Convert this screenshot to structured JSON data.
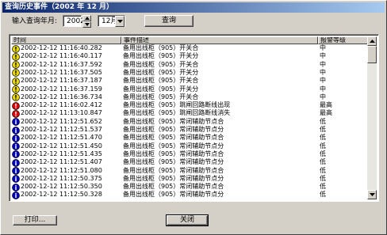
{
  "window": {
    "title": "查询历史事件（2002 年 12 月）"
  },
  "query": {
    "label": "输入查询年月:",
    "year": "2002",
    "month": "12月",
    "button": "查询"
  },
  "table": {
    "columns": [
      "时间",
      "事件描述",
      "报警等级"
    ],
    "rows": [
      {
        "icon": "warning-icon",
        "time": "2002-12-12   11:16:40.282",
        "desc": "备用出线柜（905）开关合",
        "level": "中"
      },
      {
        "icon": "warning-icon",
        "time": "2002-12-12   11:16:40.117",
        "desc": "备用出线柜（905）开关分",
        "level": "中"
      },
      {
        "icon": "warning-icon",
        "time": "2002-12-12   11:16:37.592",
        "desc": "备用出线柜（905）开关合",
        "level": "中"
      },
      {
        "icon": "warning-icon",
        "time": "2002-12-12   11:16:37.505",
        "desc": "备用出线柜（905）开关分",
        "level": "中"
      },
      {
        "icon": "warning-icon",
        "time": "2002-12-12   11:16:37.187",
        "desc": "备用出线柜（905）开关合",
        "level": "中"
      },
      {
        "icon": "warning-icon",
        "time": "2002-12-12   11:16:37.159",
        "desc": "备用出线柜（905）开关分",
        "level": "中"
      },
      {
        "icon": "warning-icon",
        "time": "2002-12-12   11:16:36.734",
        "desc": "备用出线柜（905）开关合",
        "level": "中"
      },
      {
        "icon": "error-icon",
        "time": "2002-12-12   11:16:02.412",
        "desc": "备用出线柜（905）跳闸回路断线出现",
        "level": "最高"
      },
      {
        "icon": "error-icon",
        "time": "2002-12-12   11:13:10.847",
        "desc": "备用出线柜（905）跳闸回路断线消失",
        "level": "最高"
      },
      {
        "icon": "info-icon",
        "time": "2002-12-12   11:12:51.652",
        "desc": "备用出线柜（905）常闭辅助节点合",
        "level": "低"
      },
      {
        "icon": "info-icon",
        "time": "2002-12-12   11:12:51.537",
        "desc": "备用出线柜（905）常闭辅助节点分",
        "level": "低"
      },
      {
        "icon": "info-icon",
        "time": "2002-12-12   11:12:51.470",
        "desc": "备用出线柜（905）常闭辅助节点合",
        "level": "低"
      },
      {
        "icon": "info-icon",
        "time": "2002-12-12   11:12:51.450",
        "desc": "备用出线柜（905）常闭辅助节点分",
        "level": "低"
      },
      {
        "icon": "info-icon",
        "time": "2002-12-12   11:12:51.435",
        "desc": "备用出线柜（905）常闭辅助节点合",
        "level": "低"
      },
      {
        "icon": "info-icon",
        "time": "2002-12-12   11:12:51.407",
        "desc": "备用出线柜（905）常闭辅助节点分",
        "level": "低"
      },
      {
        "icon": "info-icon",
        "time": "2002-12-12   11:12:51.080",
        "desc": "备用出线柜（905）常闭辅助节点合",
        "level": "低"
      },
      {
        "icon": "info-icon",
        "time": "2002-12-12   11:12:50.375",
        "desc": "备用出线柜（905）常闭辅助节点分",
        "level": "低"
      },
      {
        "icon": "info-icon",
        "time": "2002-12-12   11:12:50.350",
        "desc": "备用出线柜（905）常闭辅助节点合",
        "level": "低"
      },
      {
        "icon": "info-icon",
        "time": "2002-12-12   11:12:50.328",
        "desc": "备用出线柜（905）常闭辅助节点分",
        "level": "低"
      }
    ]
  },
  "footer": {
    "print_button": "打印...",
    "close_button": "关闭"
  },
  "colors": {
    "titlebar": "#0a246a",
    "warning": "#e8d800",
    "error": "#e00000",
    "info": "#0000c8"
  }
}
